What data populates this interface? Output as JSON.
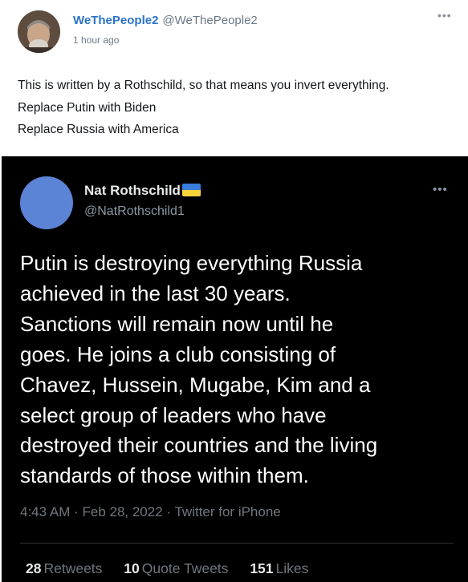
{
  "post": {
    "display_name": "WeThePeople2",
    "handle": "@WeThePeople2",
    "time": "1 hour ago",
    "menu_icon": "more-horizontal-icon",
    "lines": [
      "This is written by a Rothschild, so that means you invert everything.",
      "Replace Putin with Biden",
      "Replace Russia with America"
    ]
  },
  "tweet": {
    "display_name": "Nat Rothschild",
    "flag_icon": "ukraine-flag-icon",
    "handle": "@NatRothschild1",
    "menu_icon": "more-horizontal-icon",
    "text_lines": [
      "Putin is destroying everything Russia",
      "achieved in the last 30 years.",
      "Sanctions will remain now until he",
      "goes. He joins a club consisting of",
      "Chavez, Hussein, Mugabe, Kim and a",
      "select group of leaders who have",
      "destroyed their countries and the living",
      "standards of those within them."
    ],
    "meta": "4:43 AM · Feb 28, 2022 · Twitter for iPhone",
    "stats": {
      "retweets_count": "28",
      "retweets_label": "Retweets",
      "quotes_count": "10",
      "quotes_label": "Quote Tweets",
      "likes_count": "151",
      "likes_label": "Likes"
    }
  },
  "colors": {
    "post_name": "#2a73c7",
    "tweet_bg": "#000000",
    "tweet_avatar": "#5b84d6",
    "flag_blue": "#3b7ddd",
    "flag_yellow": "#f8d43a"
  }
}
